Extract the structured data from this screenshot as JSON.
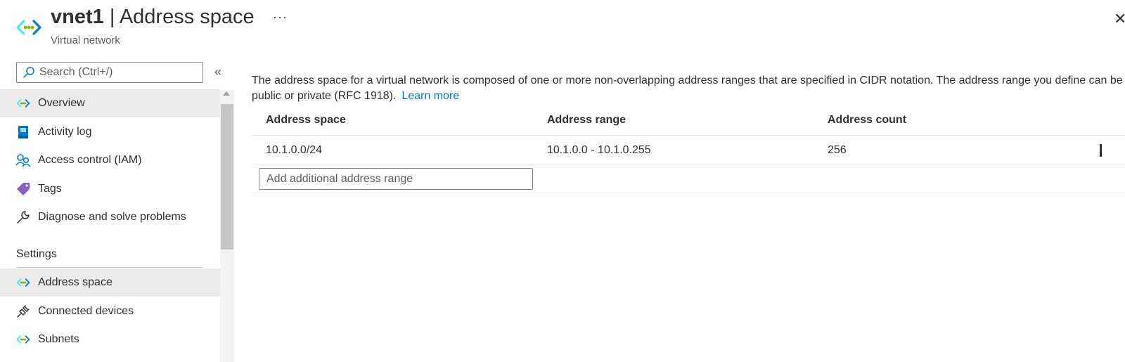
{
  "header": {
    "resource_name": "vnet1",
    "separator": " | ",
    "blade_title": "Address space",
    "subtitle": "Virtual network",
    "more_label": "···",
    "close_label": "✕"
  },
  "sidebar": {
    "search": {
      "placeholder": "Search (Ctrl+/)",
      "value": ""
    },
    "collapse_label": "«",
    "items": [
      {
        "label": "Overview",
        "icon": "vnet-icon",
        "active": true
      },
      {
        "label": "Activity log",
        "icon": "activity-log-icon",
        "active": false
      },
      {
        "label": "Access control (IAM)",
        "icon": "people-icon",
        "active": false
      },
      {
        "label": "Tags",
        "icon": "tag-icon",
        "active": false
      },
      {
        "label": "Diagnose and solve problems",
        "icon": "wrench-icon",
        "active": false
      }
    ],
    "section": "Settings",
    "settings_items": [
      {
        "label": "Address space",
        "icon": "vnet-icon",
        "active": true
      },
      {
        "label": "Connected devices",
        "icon": "plug-icon",
        "active": false
      },
      {
        "label": "Subnets",
        "icon": "vnet-icon",
        "active": false
      }
    ]
  },
  "main": {
    "description": "The address space for a virtual network is composed of one or more non-overlapping address ranges that are specified in CIDR notation. The address range you define can be public or private (RFC 1918).",
    "learn_more": "Learn more",
    "table": {
      "columns": [
        "Address space",
        "Address range",
        "Address count"
      ],
      "rows": [
        {
          "address_space": "10.1.0.0/24",
          "address_range": "10.1.0.0 - 10.1.0.255",
          "address_count": "256"
        }
      ]
    },
    "add_input": {
      "placeholder": "Add additional address range",
      "value": ""
    }
  },
  "colors": {
    "accent": "#0078d4",
    "vnet_cyan": "#50e6ff",
    "vnet_green": "#7fba00",
    "active_bg": "#edebe9",
    "tag_purple": "#8661c5"
  }
}
